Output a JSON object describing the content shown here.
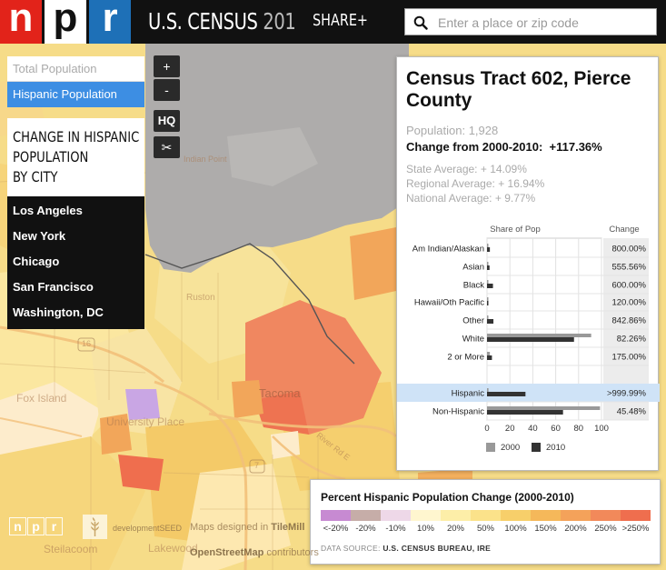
{
  "header": {
    "logo_letters": [
      "n",
      "p",
      "r"
    ],
    "title_main": "U.S. CENSUS",
    "title_num": "201",
    "share_label": "SHARE+"
  },
  "search": {
    "placeholder": "Enter a place or zip code",
    "value": ""
  },
  "layers": {
    "total_population": "Total Population",
    "hispanic_population": "Hispanic Population"
  },
  "city_panel": {
    "heading_lines": [
      "CHANGE IN HISPANIC",
      "POPULATION",
      "BY CITY"
    ],
    "cities": [
      "Los Angeles",
      "New York",
      "Chicago",
      "San Francisco",
      "Washington, DC"
    ]
  },
  "map_controls": {
    "zoom_in": "+",
    "zoom_out": "-",
    "hq": "HQ",
    "scissors": "✂"
  },
  "map_labels": {
    "fox_island": "Fox Island",
    "university_place": "University Place",
    "tacoma": "Tacoma",
    "ruston": "Ruston",
    "lakewood": "Lakewood",
    "steilacoom": "Steilacoom",
    "river_road": "River Rd E",
    "hwy16": "16",
    "hwy7": "7",
    "dolan_point": "Indian Point"
  },
  "info_panel": {
    "title": "Census Tract 602, Pierce County",
    "population_label": "Population:",
    "population_value": "1,928",
    "change_label": "Change from 2000-2010:",
    "change_value": "+117.36%",
    "state_avg_label": "State Average:",
    "state_avg_value": "+ 14.09%",
    "regional_avg_label": "Regional Average:",
    "regional_avg_value": "+ 16.94%",
    "national_avg_label": "National Average:",
    "national_avg_value": "+ 9.77%"
  },
  "chart_data": {
    "type": "bar",
    "orientation": "horizontal",
    "header_share": "Share of Pop",
    "header_change": "Change",
    "categories": [
      "Am Indian/Alaskan",
      "Asian",
      "Black",
      "Hawaii/Oth Pacific",
      "Other",
      "White",
      "2 or More",
      "Hispanic",
      "Non-Hispanic"
    ],
    "series": [
      {
        "name": "2000",
        "values": [
          0.6,
          0.6,
          0.6,
          0.15,
          0.7,
          91,
          2.5,
          1.3,
          98.7
        ]
      },
      {
        "name": "2010",
        "values": [
          2.5,
          2.2,
          5.2,
          0.3,
          5.6,
          76,
          4.3,
          33.6,
          66.4
        ]
      }
    ],
    "changes": [
      "800.00%",
      "555.56%",
      "600.00%",
      "120.00%",
      "842.86%",
      "82.26%",
      "175.00%",
      ">999.99%",
      "45.48%"
    ],
    "highlight_category": "Hispanic",
    "x_ticks": [
      0,
      20,
      40,
      60,
      80,
      100
    ],
    "xlim": [
      0,
      100
    ],
    "legend": [
      "2000",
      "2010"
    ],
    "colors": {
      "2000": "#999999",
      "2010": "#333333",
      "highlight_row": "#cfe3f7"
    }
  },
  "legend": {
    "title": "Percent Hispanic Population Change (2000-2010)",
    "labels": [
      "<-20%",
      "-20%",
      "-10%",
      "10%",
      "20%",
      "50%",
      "100%",
      "150%",
      "200%",
      "250%",
      ">250%"
    ],
    "colors": [
      "#c78ad2",
      "#c6ada8",
      "#eed8e8",
      "#fff6cf",
      "#fdeea8",
      "#fbe28a",
      "#f7cf6a",
      "#f5b85a",
      "#f4a25a",
      "#f2895a",
      "#ef6e4e"
    ],
    "source_label": "DATA SOURCE:",
    "source_value": "U.S. CENSUS BUREAU, IRE"
  },
  "credits": {
    "npr_letters": [
      "n",
      "p",
      "r"
    ],
    "development_seed": "developmentSEED",
    "maps_designed": "Maps designed in",
    "tilemill": "TileMill",
    "osm": "OpenStreetMap",
    "osm_suffix": "contributors"
  }
}
